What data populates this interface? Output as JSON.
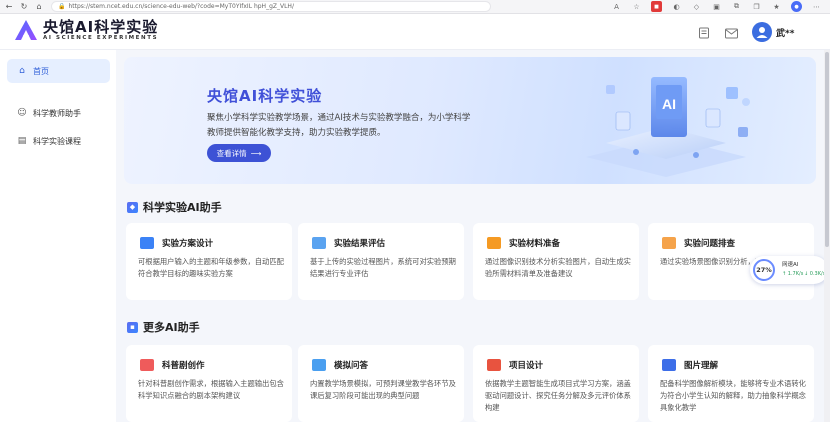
{
  "browser": {
    "url": "https://stem.ncet.edu.cn/science-edu-web/?code=MyT0YIfxIL hpH_gZ_VLH/"
  },
  "header": {
    "logo_title": "央馆AI科学实验",
    "logo_subtitle": "AI SCIENCE EXPERIMENTS",
    "username": "武**"
  },
  "sidebar": {
    "items": [
      {
        "label": "首页",
        "icon": "home-icon"
      },
      {
        "label": "科学教师助手",
        "icon": "assistant-icon"
      },
      {
        "label": "科学实验课程",
        "icon": "course-icon"
      }
    ]
  },
  "banner": {
    "title": "央馆AI科学实验",
    "desc": "聚焦小学科学实验教学场景，通过AI技术与实验教学融合，为小学科学教师提供智能化教学支持，助力实验教学提质。",
    "button": "查看详情"
  },
  "section1": {
    "title": "科学实验AI助手",
    "cards": [
      {
        "title": "实验方案设计",
        "desc": "可根据用户输入的主题和年级参数，自动匹配符合教学目标的趣味实验方案",
        "color": "#3b82f6"
      },
      {
        "title": "实验结果评估",
        "desc": "基于上传的实验过程图片，系统可对实验预期结果进行专业评估",
        "color": "#5aa3f0"
      },
      {
        "title": "实验材料准备",
        "desc": "通过图像识别技术分析实验图片，自动生成实验所需材料清单及准备建议",
        "color": "#f59a23"
      },
      {
        "title": "实验问题排查",
        "desc": "通过实验场景图像识别分析，定位实验问题",
        "color": "#f5a34a"
      }
    ]
  },
  "section2": {
    "title": "更多AI助手",
    "cards": [
      {
        "title": "科普剧创作",
        "desc": "针对科普剧创作需求，根据输入主题输出包含科学知识点融合的剧本架构建议",
        "color": "#ef5b5b"
      },
      {
        "title": "模拟问答",
        "desc": "内置教学场景模拟，可预判课堂教学各环节及课后复习阶段可能出现的典型问题",
        "color": "#4a9ff0"
      },
      {
        "title": "项目设计",
        "desc": "依据教学主题智能生成项目式学习方案，涵盖驱动问题设计、探究任务分解及多元评价体系构建",
        "color": "#e8533f"
      },
      {
        "title": "图片理解",
        "desc": "配备科学图像解析模块，能够将专业术语转化为符合小学生认知的解释，助力抽象科学概念具象化教学",
        "color": "#3d6ee8"
      }
    ]
  },
  "floating": {
    "percent": "27%",
    "name": "网速AI",
    "up": "↑ 1.7K/s",
    "down": "↓ 0.3K/s"
  }
}
